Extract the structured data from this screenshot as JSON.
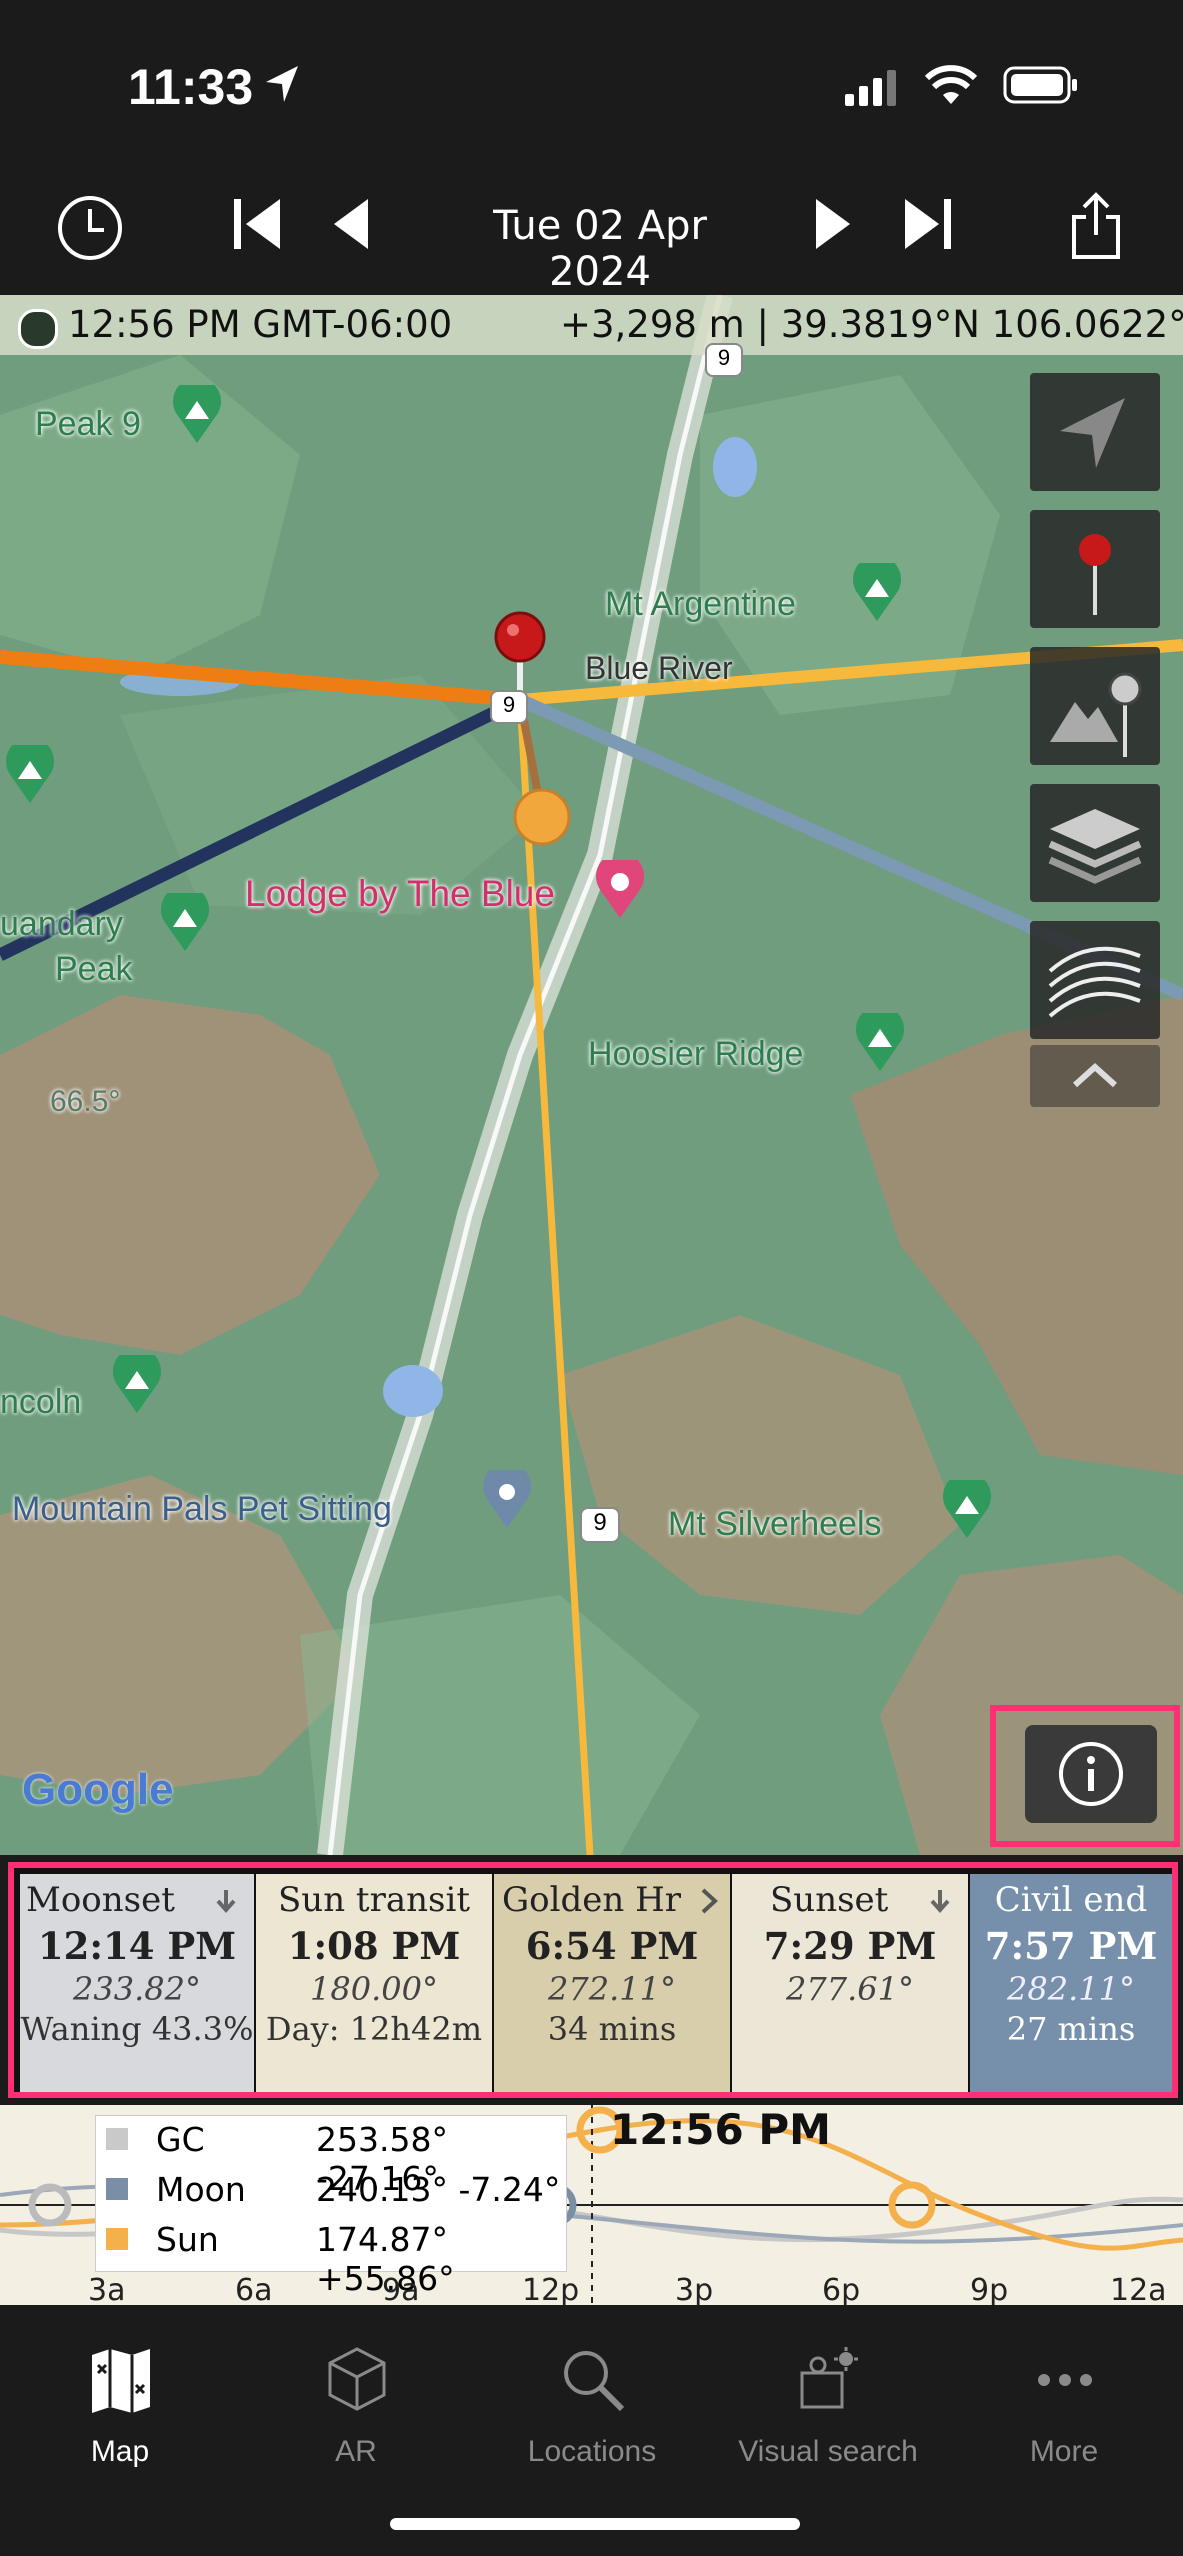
{
  "status_bar": {
    "time": "11:33"
  },
  "toolbar": {
    "date": "Tue 02 Apr 2024"
  },
  "info_strip": {
    "time_zone": "12:56 PM GMT-06:00",
    "elevation_coords": "+3,298 m | 39.3819°N 106.0622°W"
  },
  "map": {
    "labels": {
      "peak9": "Peak 9",
      "mt_argentine": "Mt Argentine",
      "blue_river": "Blue River",
      "lodge": "Lodge by The Blue",
      "quandary1": "uandary",
      "quandary2": "Peak",
      "hoosier": "Hoosier Ridge",
      "lincoln": "ncoln",
      "pet_sitting": "Mountain Pals Pet Sitting",
      "silverheels": "Mt Silverheels",
      "route_top": "9",
      "route_mid": "9",
      "route_low": "9",
      "google": "Google",
      "bearing": "66.5°"
    }
  },
  "events": [
    {
      "name": "Moonset",
      "time": "12:14 PM",
      "azimuth": "233.82°",
      "extra": "Waning 43.3%",
      "bg": "#d7d9dc"
    },
    {
      "name": "Sun transit",
      "time": "1:08 PM",
      "azimuth": "180.00°",
      "extra": "Day: 12h42m",
      "bg": "#ece6d3"
    },
    {
      "name": "Golden Hr",
      "time": "6:54 PM",
      "azimuth": "272.11°",
      "extra": "34 mins",
      "bg": "#d9ceac"
    },
    {
      "name": "Sunset",
      "time": "7:29 PM",
      "azimuth": "277.61°",
      "extra": "",
      "bg": "#ece6d6"
    },
    {
      "name": "Civil end",
      "time": "7:57 PM",
      "azimuth": "282.11°",
      "extra": "27 mins",
      "bg": "#7690ab"
    }
  ],
  "chart": {
    "current_time": "12:56 PM",
    "legend": [
      {
        "name": "GC",
        "value": "253.58° -27.16°",
        "color": "#c9c9c9"
      },
      {
        "name": "Moon",
        "value": "240.13°  -7.24°",
        "color": "#7a8ea6"
      },
      {
        "name": "Sun",
        "value": "174.87°+55.86°",
        "color": "#f4b04a"
      }
    ],
    "ticks": [
      "3a",
      "6a",
      "9a",
      "12p",
      "3p",
      "6p",
      "9p",
      "12a"
    ]
  },
  "tabs": [
    {
      "label": "Map",
      "icon": "map-icon"
    },
    {
      "label": "AR",
      "icon": "cube-icon"
    },
    {
      "label": "Locations",
      "icon": "search-icon"
    },
    {
      "label": "Visual search",
      "icon": "visual-search-icon"
    },
    {
      "label": "More",
      "icon": "more-icon"
    }
  ]
}
